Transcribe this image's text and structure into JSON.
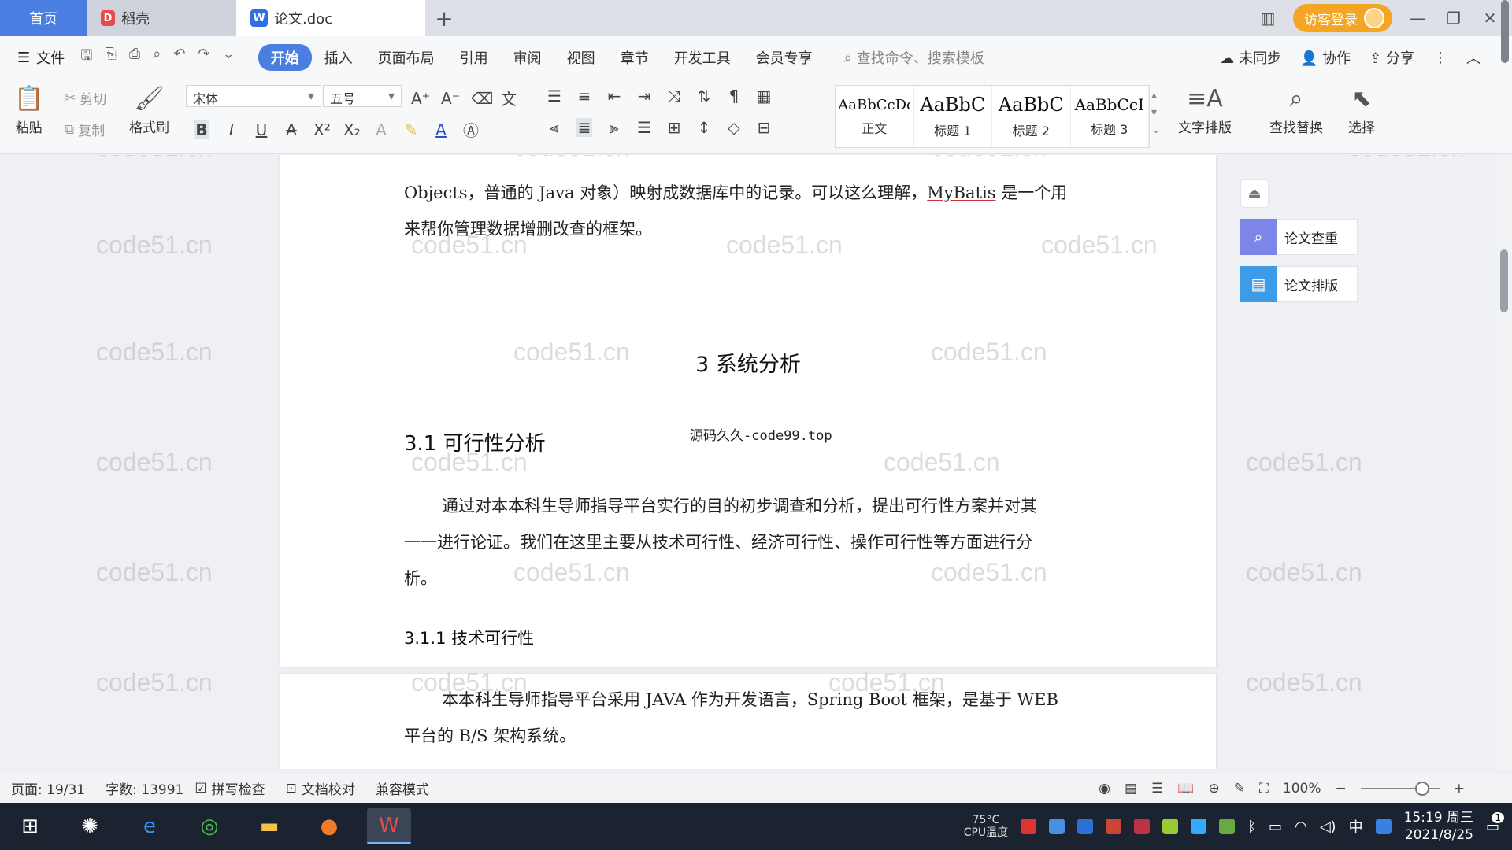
{
  "tabs": {
    "home": "首页",
    "docer": "稻壳",
    "doc": "论文.doc",
    "plus": "+",
    "login": "访客登录"
  },
  "menu": {
    "file": "文件",
    "items": [
      "开始",
      "插入",
      "页面布局",
      "引用",
      "审阅",
      "视图",
      "章节",
      "开发工具",
      "会员专享"
    ],
    "search": "查找命令、搜索模板",
    "sync": "未同步",
    "collab": "协作",
    "share": "分享"
  },
  "ribbon": {
    "paste": "粘贴",
    "cut": "剪切",
    "copy": "复制",
    "format_painter": "格式刷",
    "font": "宋体",
    "size": "五号",
    "styles": [
      {
        "sample": "AaBbCcDd",
        "label": "正文"
      },
      {
        "sample": "AaBbC",
        "label": "标题 1"
      },
      {
        "sample": "AaBbC",
        "label": "标题 2"
      },
      {
        "sample": "AaBbCcI",
        "label": "标题 3"
      }
    ],
    "text_layout": "文字排版",
    "find_replace": "查找替换",
    "select": "选择"
  },
  "document": {
    "para1_line1_a": "Objects，普通的 Java 对象）映射成数据库中的记录。可以这么理解，",
    "para1_link": "MyBatis",
    "para1_line1_b": " 是一个用",
    "para1_line2": "来帮你管理数据增删改查的框架。",
    "heading1": "3 系统分析",
    "heading2": "3.1 可行性分析",
    "stamp": "源码久久-code99.top",
    "para2_line1": "通过对本本科生导师指导平台实行的目的初步调查和分析，提出可行性方案并对其",
    "para2_line2": "一一进行论证。我们在这里主要从技术可行性、经济可行性、操作可行性等方面进行分",
    "para2_line3": "析。",
    "heading3": "3.1.1 技术可行性",
    "para3_line1": "本本科生导师指导平台采用 JAVA 作为开发语言，Spring Boot 框架，是基于 WEB",
    "para3_line2": "平台的 B/S 架构系统。"
  },
  "watermark": "code51.cn",
  "side_panel": {
    "check": "论文查重",
    "layout": "论文排版",
    "check_color": "#7b86e8",
    "layout_color": "#3d9be8"
  },
  "status": {
    "page": "页面: 19/31",
    "words": "字数: 13991",
    "spell": "拼写检查",
    "proof": "文档校对",
    "compat": "兼容模式",
    "zoom": "100%",
    "zoom_fraction": 0.78
  },
  "taskbar": {
    "temp": "75°C",
    "cpu": "CPU温度",
    "ime": "中",
    "time": "15:19 周三",
    "date": "2021/8/25",
    "notifications": "1"
  },
  "colors": {
    "accent": "#4a7fe1",
    "login": "#f5a524"
  }
}
